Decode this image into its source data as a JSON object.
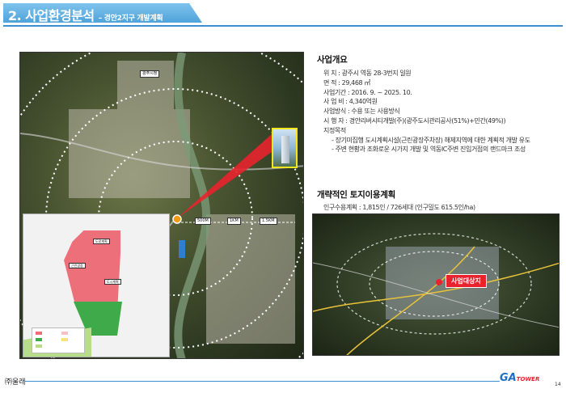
{
  "header": {
    "title": "2. 사업환경분석",
    "subtitle": "– 경안2지구 개발계획"
  },
  "overview": {
    "title": "사업개요",
    "rows": [
      "위 치 : 광주시 역동 28-3번지 일원",
      "면 적 : 29,468 ㎡",
      "사업기간 : 2016. 9. ~ 2025. 10.",
      "사 업 비 : 4,340억원",
      "사업방식 : 수용 또는 사용방식",
      "시 행 자 : 경안리버시티개발(주)(광주도시관리공사(51%)+민간(49%))",
      "지정목적"
    ],
    "purposes": [
      "장기미집행 도시계획시설(근린광장주차장) 해제지역에 대한 계획적 개발 유도",
      "주변 현황과 조화로운 시가지 개발 및 역동IC주변 진입거점의 랜드마크 조성"
    ]
  },
  "landuse": {
    "title": "개략적인 토지이용계획",
    "population": "인구수용계획 : 1,815인 / 726세대 (인구밀도 615.5인/ha)"
  },
  "main_map": {
    "labels": [
      "광주시청",
      "500M",
      "1KM",
      "1.5KM"
    ],
    "inset_zones": [
      "도로계획",
      "근린광장",
      "도시계획"
    ]
  },
  "right_map": {
    "site_label": "사업대상지"
  },
  "footer": {
    "company": "㈜울래",
    "logo_main": "GA",
    "logo_sub": "TOWER",
    "page": "14"
  }
}
